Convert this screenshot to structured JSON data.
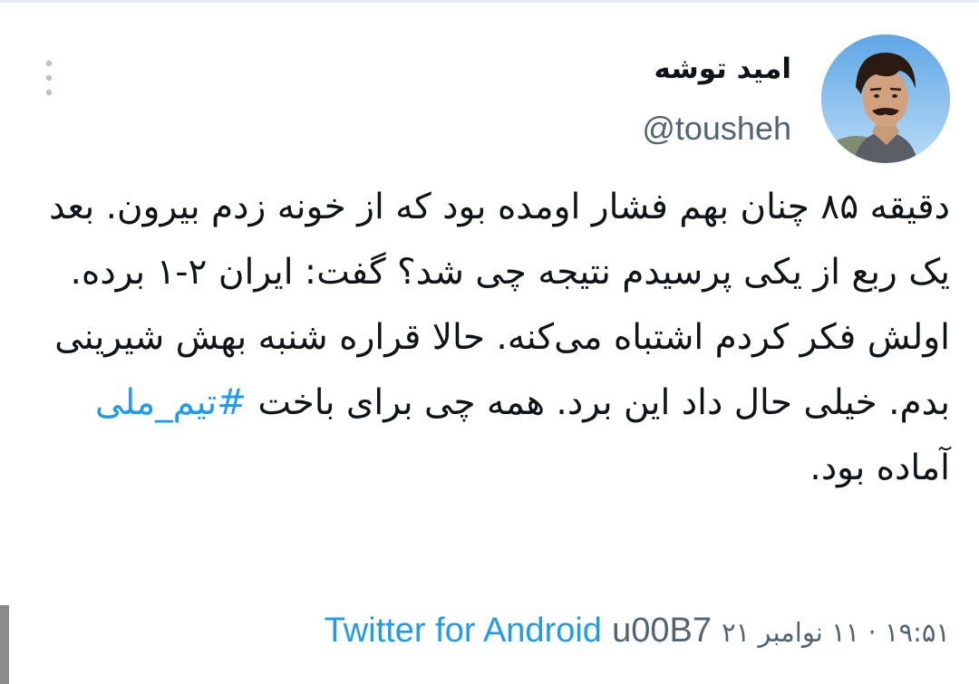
{
  "author": {
    "display_name": "امید توشه",
    "handle": "@tousheh",
    "avatar_icon": "avatar-photo"
  },
  "menu": {
    "icon": "more-vertical-icon"
  },
  "tweet": {
    "text_before_hashtag": "دقیقه ۸۵ چنان بهم فشار اومده بود که از خونه زدم بیرون. بعد یک ربع از یکی پرسیدم نتیجه چی شد؟ گفت: ایران ۲-۱ برده. اولش فکر کردم اشتباه می‌کنه. حالا قراره شنبه بهش شیرینی بدم. خیلی حال داد این برد. همه چی برای باخت ",
    "hashtag": "#تیم_ملی",
    "text_after_hashtag": " آماده بود."
  },
  "meta": {
    "timestamp": "۱۹:۵۱ · ۱۱ نوامبر ۲۱",
    "separator": "u00B7",
    "source": "Twitter for Android"
  },
  "colors": {
    "link": "#1d9bf0",
    "secondary_text": "#536471",
    "primary_text": "#0f1419"
  }
}
